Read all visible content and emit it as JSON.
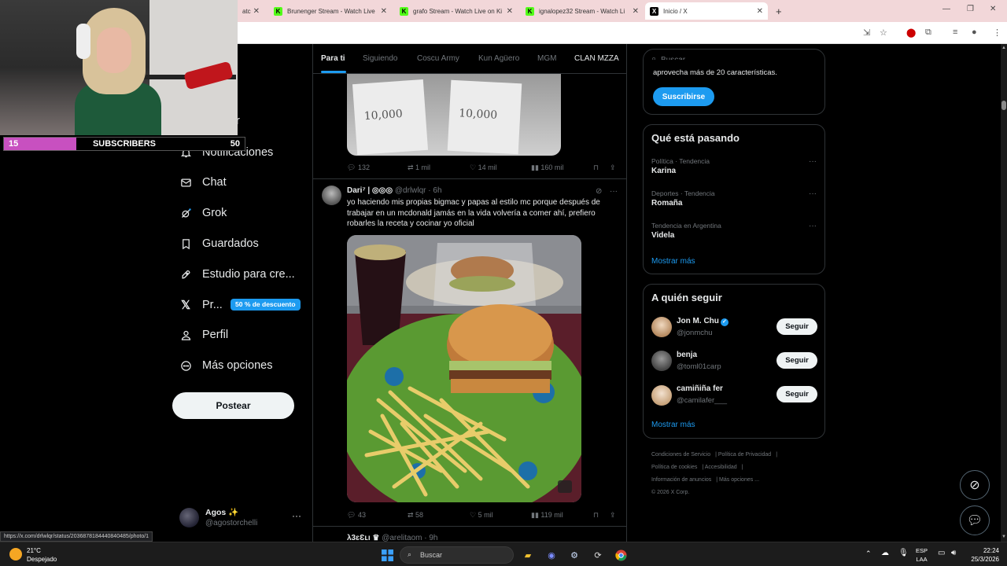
{
  "browser": {
    "tabs": [
      {
        "label": "atc",
        "favicon": "K"
      },
      {
        "label": "Brunenger Stream - Watch Live",
        "favicon": "K"
      },
      {
        "label": "grafo Stream - Watch Live on Ki",
        "favicon": "K"
      },
      {
        "label": "ignalopez32 Stream - Watch Li",
        "favicon": "K"
      },
      {
        "label": "Inicio / X",
        "favicon": "X"
      }
    ],
    "new_tab": "+",
    "status_url": "https://x.com/drlwlqr/status/2036878184440840485/photo/1"
  },
  "overlay": {
    "subscribers_current": "15",
    "subscribers_label": "SUBSCRIBERS",
    "subscribers_goal": "50",
    "subscribers_progress": 0.3
  },
  "nav": {
    "partial_label": "r",
    "items": [
      {
        "label": "Notificaciones",
        "icon": "bell-icon"
      },
      {
        "label": "Chat",
        "icon": "mail-icon"
      },
      {
        "label": "Grok",
        "icon": "grok-icon"
      },
      {
        "label": "Guardados",
        "icon": "bookmark-icon"
      },
      {
        "label": "Estudio para cre...",
        "icon": "rocket-icon"
      },
      {
        "label": "Pr...",
        "icon": "x-logo-icon"
      },
      {
        "label": "Perfil",
        "icon": "person-icon"
      },
      {
        "label": "Más opciones",
        "icon": "more-circle-icon"
      }
    ],
    "premium_badge": "50 % de descuento",
    "post_button": "Postear",
    "account_name": "Agos ✨",
    "account_handle": "@agostorchelli"
  },
  "timeline": {
    "tabs": [
      "Para ti",
      "Siguiendo",
      "Coscu Army",
      "Kun Agüero",
      "MGM",
      "CLAN MZZA"
    ],
    "active_tab": "Para ti",
    "prev_tweet": {
      "envelope_text_1": "10,000",
      "envelope_text_2": "10,000",
      "replies": "132",
      "reposts": "1 mil",
      "likes": "14 mil",
      "views": "160 mil"
    },
    "tweet": {
      "name": "Dari⁷ | ◎◎◎",
      "handle": "@drlwlqr",
      "time": "6h",
      "text": "yo haciendo mis propias bigmac y papas al estilo mc porque después de trabajar en un mcdonald jamás en la vida volvería a comer ahí, prefiero robarles la receta y cocinar yo oficial",
      "replies": "43",
      "reposts": "58",
      "likes": "5 mil",
      "views": "119 mil"
    },
    "next_tweet": {
      "name": "λ3ɛƐʟı ♛",
      "handle": "@arelitaom",
      "time": "9h"
    }
  },
  "sidebar": {
    "search_placeholder": "Buscar",
    "premium_text": "aprovecha más de 20 características.",
    "subscribe_button": "Suscribirse",
    "trends_title": "Qué está pasando",
    "trends": [
      {
        "meta": "Política · Tendencia",
        "name": "Karina"
      },
      {
        "meta": "Deportes · Tendencia",
        "name": "Romaña"
      },
      {
        "meta": "Tendencia en Argentina",
        "name": "Videla"
      }
    ],
    "trends_more": "Mostrar más",
    "follow_title": "A quién seguir",
    "follow": [
      {
        "name": "Jon M. Chu",
        "handle": "@jonmchu",
        "verified": true
      },
      {
        "name": "benja",
        "handle": "@toml01carp",
        "verified": false
      },
      {
        "name": "camiñiña fer",
        "handle": "@camilafer___",
        "verified": false
      }
    ],
    "follow_button": "Seguir",
    "follow_more": "Mostrar más",
    "footer": [
      "Condiciones de Servicio",
      "Política de Privacidad",
      "Política de cookies",
      "Accesibilidad",
      "Información de anuncios",
      "Más opciones ...",
      "© 2026 X Corp."
    ]
  },
  "taskbar": {
    "temperature": "21°C",
    "weather": "Despejado",
    "search": "Buscar",
    "lang_1": "ESP",
    "lang_2": "LAA",
    "time": "22:24",
    "date": "25/3/2026"
  },
  "colors": {
    "accent": "#1d9bf0",
    "kick_green": "#53fc18",
    "sub_bar": "#c850c0"
  }
}
